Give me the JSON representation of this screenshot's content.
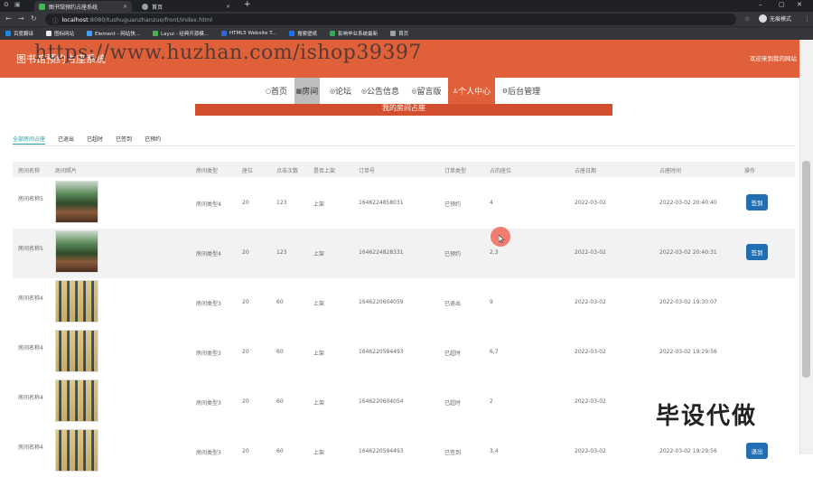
{
  "browser": {
    "tabs": [
      {
        "label": "图书馆预约占座系统",
        "icon_color": "#3cba54"
      },
      {
        "label": "首页",
        "icon_color": "#9aa0a6"
      }
    ],
    "new_tab": "+",
    "close_x": "×",
    "url_host": "localhost",
    "url_path": ":8080/tushuguanzhanzuo/front/index.html",
    "profile_label": "无痕模式",
    "bookmarks": [
      {
        "label": "百度翻译",
        "color": "#1e88e5"
      },
      {
        "label": "图标网站",
        "color": "#e8eaed"
      },
      {
        "label": "Element - 网站快...",
        "color": "#409eff"
      },
      {
        "label": "Layui - 经典开源模...",
        "color": "#4caf50"
      },
      {
        "label": "HTML5 Website T...",
        "color": "#3367d6"
      },
      {
        "label": "搜索壁纸",
        "color": "#1a73e8"
      },
      {
        "label": "影响毕业系统最新",
        "color": "#34a853"
      },
      {
        "label": "首页",
        "color": "#9aa0a6"
      }
    ]
  },
  "site": {
    "title": "图书馆预约占座系统",
    "watermark": "https://www.huzhan.com/ishop39397",
    "welcome": "欢迎来到我的网站",
    "nav": [
      {
        "icon": "○",
        "label": "首页"
      },
      {
        "icon": "▦",
        "label": "房间"
      },
      {
        "icon": "◎",
        "label": "论坛"
      },
      {
        "icon": "◎",
        "label": "公告信息"
      },
      {
        "icon": "◎",
        "label": "留言版"
      },
      {
        "icon": "♙",
        "label": "个人中心"
      },
      {
        "icon": "⚙",
        "label": "后台管理"
      }
    ],
    "orange_bar_text": "我的房间占座"
  },
  "subtabs": [
    "全部房间占座",
    "已退出",
    "已超时",
    "已签到",
    "已预约"
  ],
  "table": {
    "headers": [
      "房间名称",
      "房间照片",
      "房间类型",
      "座位",
      "点击次数",
      "是否上架",
      "订单号",
      "订单类型",
      "占的座位",
      "占座日期",
      "占座时间",
      "操作"
    ],
    "rows": [
      {
        "name": "房间名称5",
        "type": "房间类型4",
        "seats": "20",
        "clicks": "123",
        "shelf": "上架",
        "order": "1646224858031",
        "otype": "已预约",
        "seat": "4",
        "date": "2022-03-02",
        "time": "2022-03-02 20:40:40",
        "action": "签到",
        "img": "green"
      },
      {
        "name": "房间名称5",
        "type": "房间类型4",
        "seats": "20",
        "clicks": "123",
        "shelf": "上架",
        "order": "1646224828331",
        "otype": "已预约",
        "seat": "2,3",
        "date": "2022-03-02",
        "time": "2022-03-02 20:40:31",
        "action": "签到",
        "img": "green"
      },
      {
        "name": "房间名称4",
        "type": "房间类型3",
        "seats": "20",
        "clicks": "60",
        "shelf": "上架",
        "order": "1646220604059",
        "otype": "已退出",
        "seat": "9",
        "date": "2022-03-02",
        "time": "2022-03-02 19:30:07",
        "action": "",
        "img": "shelf"
      },
      {
        "name": "房间名称4",
        "type": "房间类型3",
        "seats": "20",
        "clicks": "60",
        "shelf": "上架",
        "order": "1646220594493",
        "otype": "已超时",
        "seat": "6,7",
        "date": "2022-03-02",
        "time": "2022-03-02 19:29:56",
        "action": "",
        "img": "shelf"
      },
      {
        "name": "房间名称4",
        "type": "房间类型3",
        "seats": "20",
        "clicks": "60",
        "shelf": "上架",
        "order": "1646220604054",
        "otype": "已超时",
        "seat": "2",
        "date": "2022-03-02",
        "time": "",
        "action": "",
        "img": "shelf"
      },
      {
        "name": "房间名称4",
        "type": "房间类型3",
        "seats": "20",
        "clicks": "60",
        "shelf": "上架",
        "order": "1646220594493",
        "otype": "已签到",
        "seat": "3,4",
        "date": "2022-03-02",
        "time": "2022-03-02 19:29:56",
        "action": "退出",
        "img": "shelf"
      }
    ]
  },
  "caption": "毕设代做",
  "colors": {
    "accent": "#e0603a",
    "button": "#1f6fb2",
    "tab_active": "#2a9a9a"
  }
}
